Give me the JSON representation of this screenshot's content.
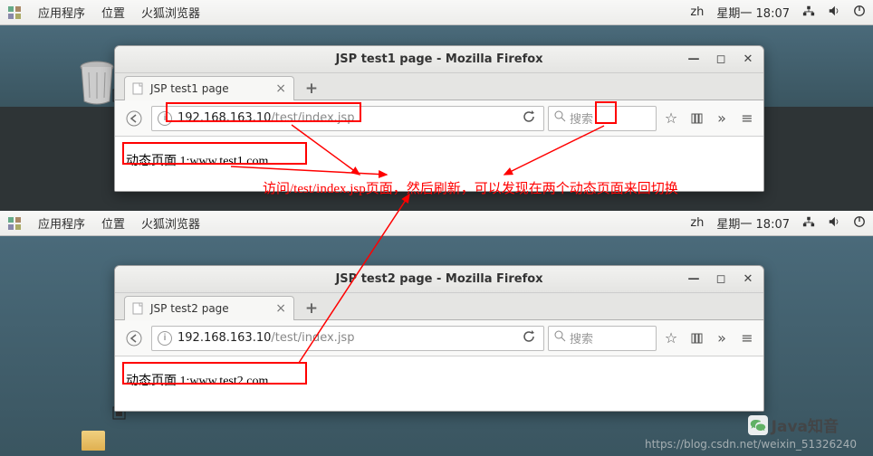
{
  "top_bar": {
    "apps": "应用程序",
    "places": "位置",
    "firefox": "火狐浏览器",
    "lang": "zh",
    "date_time": "星期一 18:07"
  },
  "window1": {
    "title": "JSP test1 page - Mozilla Firefox",
    "tab": "JSP test1 page",
    "url_dark": "192.168.163.10",
    "url_light": "/test/index.jsp",
    "search_placeholder": "搜索",
    "page_text": "动态页面 1:www.test1.com"
  },
  "window2": {
    "title": "JSP test2 page - Mozilla Firefox",
    "tab": "JSP test2 page",
    "url_dark": "192.168.163.10",
    "url_light": "/test/index.jsp",
    "search_placeholder": "搜索",
    "page_text": "动态页面 1:www.test2.com"
  },
  "annotation": {
    "text": "访问/test/index.jsp页面，然后刷新，可以发现在两个动态页面来回切换"
  },
  "watermark": {
    "blog": "https://blog.csdn.net/weixin_51326240",
    "brand": "Java知音"
  }
}
